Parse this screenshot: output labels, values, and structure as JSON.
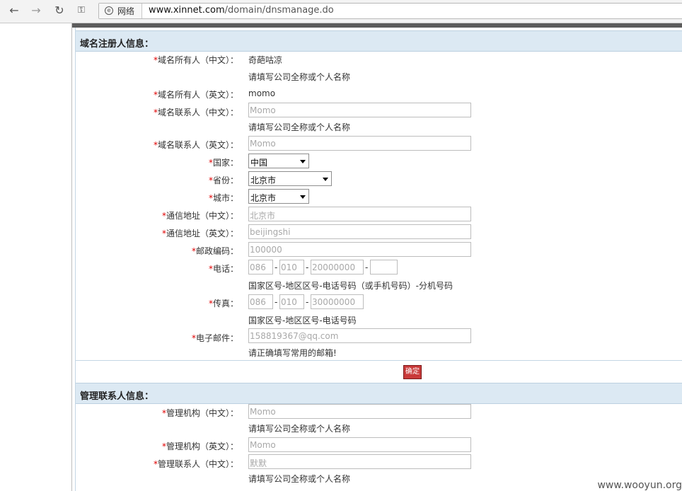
{
  "browser": {
    "net_label": "网络",
    "url_host": "www.xinnet.com",
    "url_path": "/domain/dnsmanage.do"
  },
  "sections": {
    "registrant_title": "域名注册人信息：",
    "admin_title": "管理联系人信息："
  },
  "registrant": {
    "owner_cn_label": "域名所有人（中文）：",
    "owner_cn_value": "奇葩咕凉",
    "owner_cn_hint": "请填写公司全称或个人名称",
    "owner_en_label": "域名所有人（英文）：",
    "owner_en_value": "momo",
    "contact_cn_label": "域名联系人（中文）：",
    "contact_cn_value": "Momo",
    "contact_cn_hint": "请填写公司全称或个人名称",
    "contact_en_label": "域名联系人（英文）：",
    "contact_en_value": "Momo",
    "country_label": "国家：",
    "country_value": "中国",
    "province_label": "省份：",
    "province_value": "北京市",
    "city_label": "城市：",
    "city_value": "北京市",
    "address_cn_label": "通信地址（中文）：",
    "address_cn_value": "北京市",
    "address_en_label": "通信地址（英文）：",
    "address_en_value": "beijingshi",
    "postcode_label": "邮政编码：",
    "postcode_value": "100000",
    "phone_label": "电话：",
    "phone_country": "086",
    "phone_area": "010",
    "phone_number": "20000000",
    "phone_ext": "",
    "phone_hint": "国家区号-地区区号-电话号码（或手机号码）-分机号码",
    "fax_label": "传真：",
    "fax_country": "086",
    "fax_area": "010",
    "fax_number": "30000000",
    "fax_hint": "国家区号-地区区号-电话号码",
    "email_label": "电子邮件：",
    "email_value": "158819367@qq.com",
    "email_hint": "请正确填写常用的邮箱!"
  },
  "submit_label": "确定",
  "admin": {
    "org_cn_label": "管理机构（中文）：",
    "org_cn_value": "Momo",
    "org_cn_hint": "请填写公司全称或个人名称",
    "org_en_label": "管理机构（英文）：",
    "org_en_value": "Momo",
    "contact_cn_label": "管理联系人（中文）：",
    "contact_cn_value": "默默",
    "contact_cn_hint": "请填写公司全称或个人名称"
  },
  "required_mark": "*",
  "separator": "-",
  "watermark": "www.wooyun.org",
  "colors": {
    "required": "#e00000",
    "section_bg": "#dce9f3",
    "submit_bg": "#c93a3a"
  }
}
